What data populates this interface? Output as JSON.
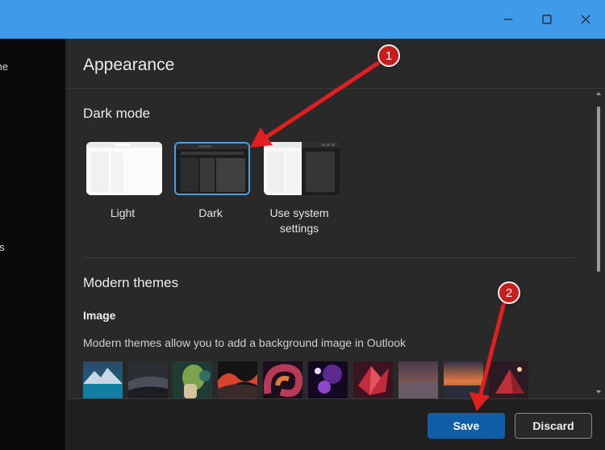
{
  "colors": {
    "titlebar": "#3f9bea",
    "accent": "#0f5ea8",
    "selected_border": "#4a9fe6",
    "annotation": "#e31e1e"
  },
  "window_controls": [
    {
      "name": "minimize-icon"
    },
    {
      "name": "maximize-icon"
    },
    {
      "name": "close-icon"
    }
  ],
  "left_pane": {
    "items": [
      {
        "label": "me"
      },
      {
        "label": "es"
      }
    ]
  },
  "panel": {
    "title": "Appearance"
  },
  "dark_mode": {
    "title": "Dark mode",
    "options": [
      {
        "label": "Light",
        "selected": false
      },
      {
        "label": "Dark",
        "selected": true
      },
      {
        "label_line1": "Use system",
        "label_line2": "settings",
        "selected": false
      }
    ]
  },
  "modern_themes": {
    "title": "Modern themes",
    "image_label": "Image",
    "description": "Modern themes allow you to add a background image in Outlook",
    "images": [
      {
        "name": "mountain-lake"
      },
      {
        "name": "dark-dunes"
      },
      {
        "name": "green-leaf"
      },
      {
        "name": "red-waves"
      },
      {
        "name": "abstract-swirl"
      },
      {
        "name": "purple-orbs"
      },
      {
        "name": "red-origami"
      },
      {
        "name": "misty-lake"
      },
      {
        "name": "sunset-bay"
      },
      {
        "name": "red-tent"
      }
    ]
  },
  "footer": {
    "save_label": "Save",
    "discard_label": "Discard"
  },
  "annotations": [
    {
      "number": "1"
    },
    {
      "number": "2"
    }
  ]
}
